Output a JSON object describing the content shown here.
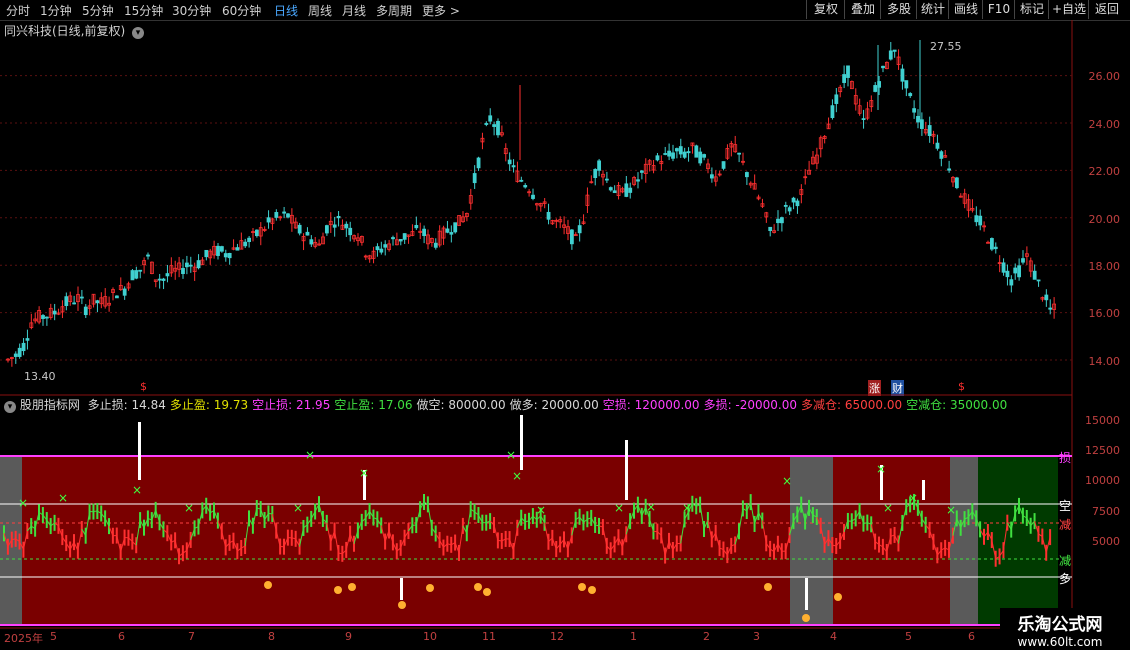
{
  "toolbar": {
    "periods": [
      "分时",
      "1分钟",
      "5分钟",
      "15分钟",
      "30分钟",
      "60分钟",
      "日线",
      "周线",
      "月线",
      "多周期",
      "更多 >"
    ],
    "active_period": "日线",
    "right_buttons": [
      "复权",
      "叠加",
      "多股",
      "统计",
      "画线",
      "F10",
      "标记",
      "+自选",
      "返回"
    ]
  },
  "stock": {
    "title": "同兴科技(日线,前复权)",
    "high_label": "27.55",
    "low_label": "13.40",
    "price_axis": [
      "26.00",
      "24.00",
      "22.00",
      "20.00",
      "18.00",
      "16.00",
      "14.00"
    ],
    "event_marks": [
      "$",
      "涨",
      "财",
      "$"
    ]
  },
  "indicator": {
    "name": "股朋指标网",
    "params": [
      {
        "label": "多止损:",
        "value": "14.84",
        "color": "#d8d8d8"
      },
      {
        "label": "多止盈:",
        "value": "19.73",
        "color": "#e0e000"
      },
      {
        "label": "空止损:",
        "value": "21.95",
        "color": "#ff40ff"
      },
      {
        "label": "空止盈:",
        "value": "17.06",
        "color": "#40e040"
      },
      {
        "label": "做空:",
        "value": "80000.00",
        "color": "#d8d8d8"
      },
      {
        "label": "做多:",
        "value": "20000.00",
        "color": "#d8d8d8"
      },
      {
        "label": "空损:",
        "value": "120000.00",
        "color": "#ff40ff"
      },
      {
        "label": "多损:",
        "value": "-20000.00",
        "color": "#ff40ff"
      },
      {
        "label": "多减仓:",
        "value": "65000.00",
        "color": "#ff4040"
      },
      {
        "label": "空减仓:",
        "value": "35000.00",
        "color": "#40e040"
      }
    ],
    "axis": [
      "15000",
      "12500",
      "10000",
      "7500",
      "5000"
    ],
    "right_tags": [
      "损",
      "空",
      "减",
      "减",
      "多"
    ]
  },
  "time_axis": [
    "2025年",
    "5",
    "6",
    "7",
    "8",
    "9",
    "10",
    "11",
    "12",
    "1",
    "2",
    "3",
    "4",
    "5",
    "6"
  ],
  "watermark": {
    "name": "乐淘公式网",
    "url": "www.60lt.com"
  },
  "colors": {
    "up": "#ff3030",
    "down": "#40d0d0",
    "zone_red": "#7a0000",
    "zone_green": "#003a00",
    "zone_gray": "#5a5a5a"
  },
  "chart_data": {
    "type": "line",
    "price_series": [
      14.0,
      14.2,
      14.6,
      15.6,
      15.8,
      15.9,
      16.0,
      16.3,
      16.5,
      16.6,
      16.2,
      16.5,
      16.4,
      16.6,
      16.9,
      17.0,
      17.6,
      17.8,
      18.3,
      17.5,
      17.4,
      17.7,
      17.8,
      18.0,
      18.0,
      18.2,
      18.5,
      18.6,
      18.5,
      18.7,
      18.9,
      19.0,
      19.3,
      19.6,
      19.9,
      20.0,
      20.1,
      19.6,
      19.3,
      19.1,
      18.8,
      19.6,
      19.9,
      19.8,
      19.5,
      19.3,
      18.6,
      18.4,
      18.7,
      18.9,
      19.1,
      19.2,
      19.3,
      19.5,
      19.1,
      19.0,
      19.3,
      19.6,
      19.8,
      20.2,
      21.6,
      23.2,
      24.2,
      23.8,
      22.8,
      22.0,
      21.6,
      21.3,
      20.8,
      20.4,
      19.9,
      19.7,
      19.4,
      19.0,
      20.0,
      21.5,
      22.3,
      21.6,
      21.2,
      21.0,
      21.3,
      21.6,
      22.0,
      22.3,
      22.5,
      22.6,
      22.8,
      22.7,
      22.9,
      22.6,
      22.2,
      21.7,
      22.3,
      23.0,
      22.6,
      21.9,
      21.2,
      20.5,
      19.4,
      19.8,
      20.3,
      20.6,
      21.0,
      22.0,
      22.6,
      23.6,
      24.5,
      25.3,
      26.2,
      25.0,
      24.0,
      24.9,
      25.8,
      26.5,
      27.2,
      26.0,
      25.0,
      24.2,
      23.8,
      23.5,
      22.8,
      22.2,
      21.4,
      20.8,
      20.2,
      19.8,
      19.2,
      18.6,
      18.0,
      17.4,
      17.8,
      18.4,
      17.6,
      16.8,
      16.1
    ]
  }
}
